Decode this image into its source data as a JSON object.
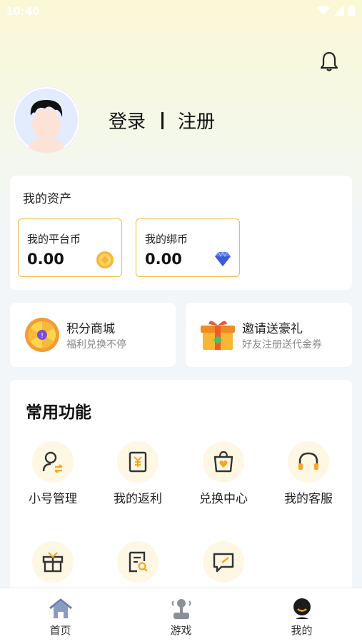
{
  "status": {
    "time": "10:40"
  },
  "auth": {
    "login": "登录",
    "register": "注册"
  },
  "assets": {
    "title": "我的资产",
    "platform_coin": {
      "label": "我的平台币",
      "value": "0.00"
    },
    "bound_coin": {
      "label": "我的绑币",
      "value": "0.00"
    }
  },
  "promos": [
    {
      "title": "积分商城",
      "subtitle": "福利兑换不停"
    },
    {
      "title": "邀请送豪礼",
      "subtitle": "好友注册送代金券"
    }
  ],
  "functions": {
    "title": "常用功能",
    "items": [
      {
        "label": "小号管理",
        "icon": "account-switch-icon"
      },
      {
        "label": "我的返利",
        "icon": "rebate-icon"
      },
      {
        "label": "兑换中心",
        "icon": "exchange-bag-icon"
      },
      {
        "label": "我的客服",
        "icon": "headset-icon"
      },
      {
        "label": "",
        "icon": "gift-icon"
      },
      {
        "label": "",
        "icon": "search-document-icon"
      },
      {
        "label": "",
        "icon": "feedback-icon"
      }
    ]
  },
  "tabs": [
    {
      "label": "首页",
      "icon": "home-icon"
    },
    {
      "label": "游戏",
      "icon": "joystick-icon"
    },
    {
      "label": "我的",
      "icon": "profile-icon"
    }
  ],
  "colors": {
    "accent": "#f5b942",
    "icon_dark": "#333333",
    "tab_home": "#6b7fa8"
  }
}
